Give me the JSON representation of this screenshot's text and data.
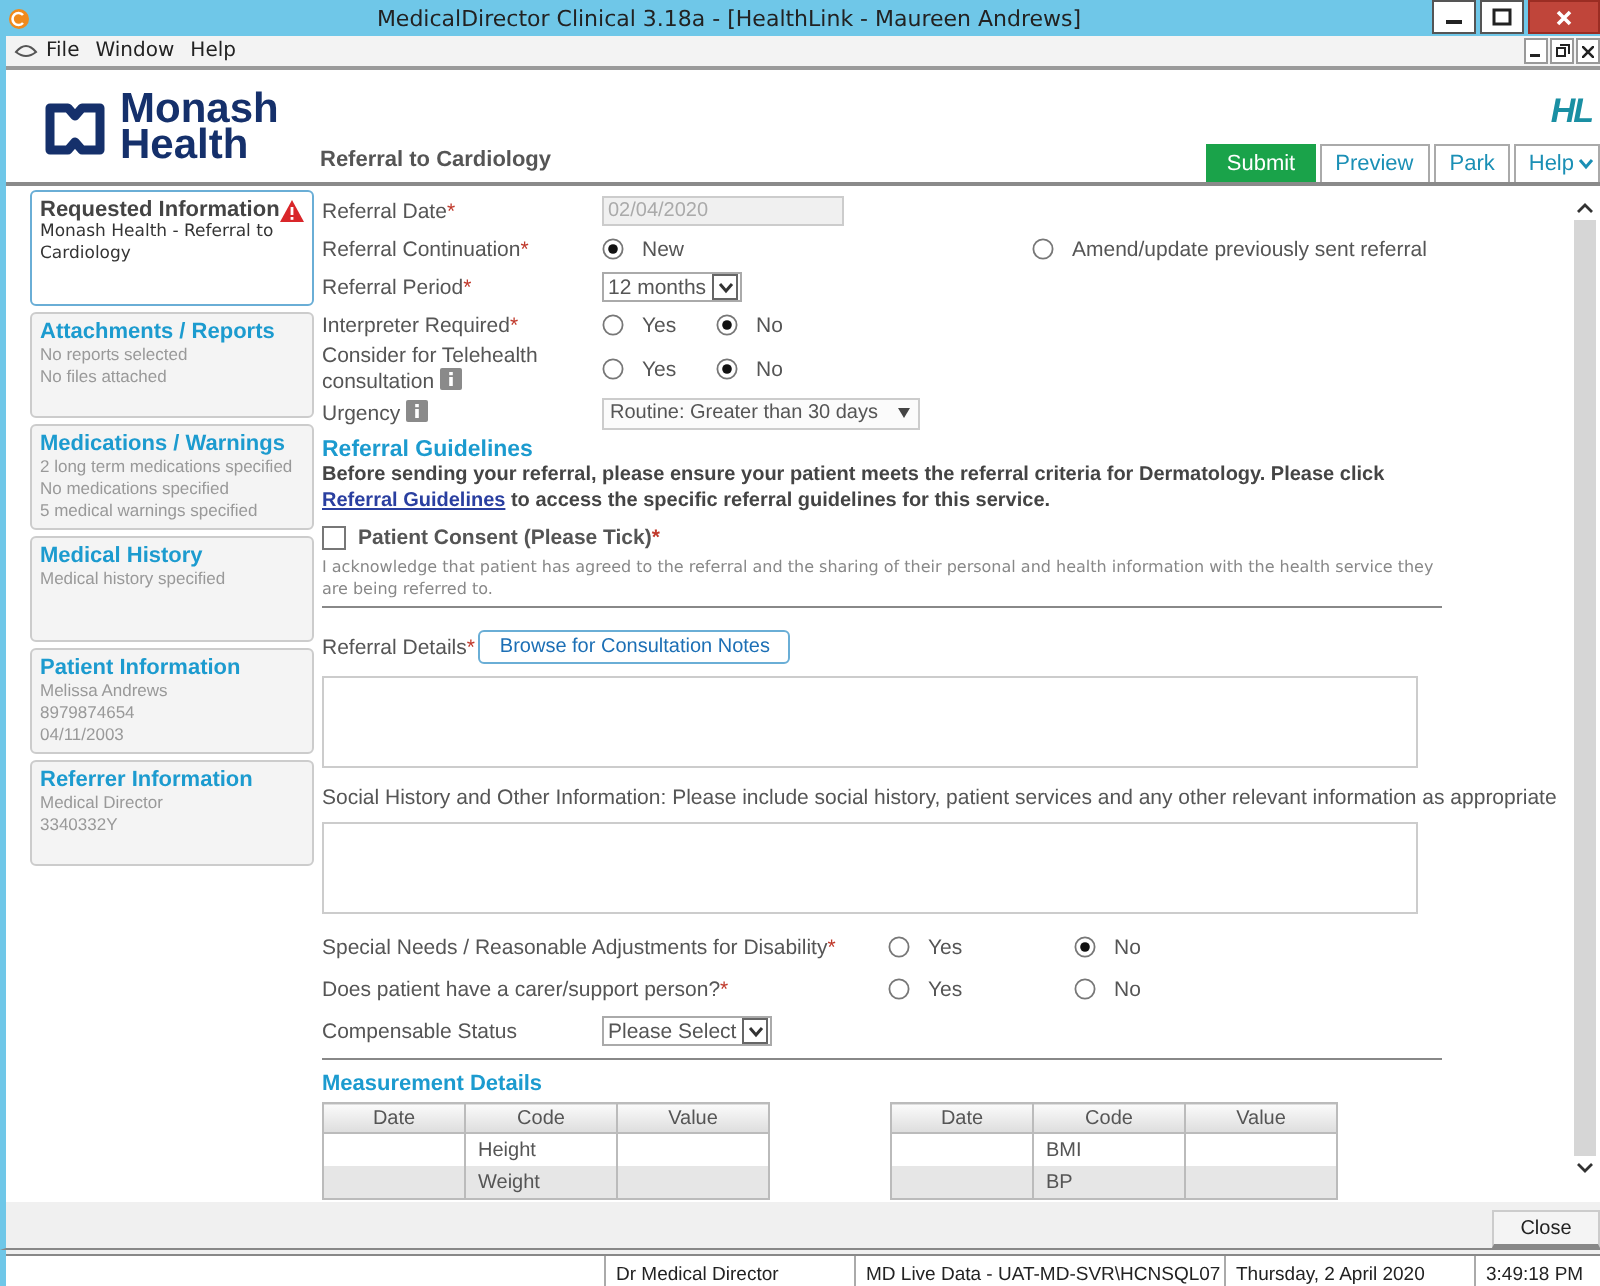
{
  "window": {
    "title": "MedicalDirector Clinical 3.18a - [HealthLink - Maureen Andrews]"
  },
  "menu": [
    "File",
    "Window",
    "Help"
  ],
  "header": {
    "logo_lines": [
      "Monash",
      "Health"
    ],
    "form_title": "Referral to Cardiology",
    "badge": "HL"
  },
  "toolbar": [
    {
      "label": "Submit",
      "kind": "primary"
    },
    {
      "label": "Preview",
      "kind": "plain"
    },
    {
      "label": "Park",
      "kind": "plain"
    },
    {
      "label": "Help",
      "kind": "menu"
    }
  ],
  "sidebar": [
    {
      "title": "Requested Information",
      "lines": [
        "Monash Health - Referral to Cardiology"
      ],
      "selected": true,
      "warning": true
    },
    {
      "title": "Attachments / Reports",
      "lines": [
        "No reports selected",
        "No files attached"
      ],
      "selected": false,
      "warning": false
    },
    {
      "title": "Medications / Warnings",
      "lines": [
        "2 long term medications specified",
        "No medications specified",
        "5 medical warnings specified"
      ],
      "selected": false,
      "warning": false
    },
    {
      "title": "Medical History",
      "lines": [
        "Medical history specified"
      ],
      "selected": false,
      "warning": false
    },
    {
      "title": "Patient Information",
      "lines": [
        "Melissa Andrews",
        "8979874654",
        "04/11/2003"
      ],
      "selected": false,
      "warning": false
    },
    {
      "title": "Referrer Information",
      "lines": [
        "Medical Director",
        "3340332Y"
      ],
      "selected": false,
      "warning": false
    }
  ],
  "form": {
    "top_fields": [
      {
        "kind": "date",
        "label": "Referral Date",
        "marker": "*",
        "value": "02/04/2020",
        "disabled": true
      },
      {
        "kind": "radio-wide",
        "label": "Referral Continuation",
        "marker": "*",
        "options": [
          {
            "label": "New",
            "selected": true
          },
          {
            "label": "Amend/update previously sent referral",
            "selected": false
          }
        ]
      },
      {
        "kind": "select",
        "label": "Referral Period",
        "marker": "*",
        "value": "12 months"
      },
      {
        "kind": "radio",
        "label": "Interpreter Required",
        "marker": "*",
        "options": [
          {
            "label": "Yes",
            "selected": false
          },
          {
            "label": "No",
            "selected": true
          }
        ]
      },
      {
        "kind": "radio",
        "label": "Consider for Telehealth consultation",
        "info": true,
        "options": [
          {
            "label": "Yes",
            "selected": false
          },
          {
            "label": "No",
            "selected": true
          }
        ]
      },
      {
        "kind": "dropdown",
        "label": "Urgency",
        "info": true,
        "value": "Routine: Greater than 30 days"
      }
    ],
    "guidelines": {
      "heading": "Referral Guidelines",
      "text_before": "Before sending your referral, please ensure your patient meets the referral criteria for Dermatology.  Please click",
      "link": "Referral Guidelines",
      "text_after": "to access the specific referral guidelines for this service."
    },
    "consent": {
      "label": "Patient Consent (Please Tick)",
      "marker": "*",
      "checked": false,
      "note": "I acknowledge that patient has agreed to the referral and the sharing of their personal and health information with the health service they are being referred to."
    },
    "referral_details": {
      "label": "Referral Details",
      "marker": "*",
      "button": "Browse for Consultation Notes"
    },
    "social_history": {
      "label": "Social History and Other Information: Please include social history, patient services and any other relevant information as appropriate"
    },
    "bottom_fields": [
      {
        "kind": "radio",
        "label": "Special Needs / Reasonable Adjustments for Disability",
        "marker": "*",
        "options": [
          {
            "label": "Yes",
            "selected": false
          },
          {
            "label": "No",
            "selected": true
          }
        ]
      },
      {
        "kind": "radio",
        "label": "Does patient have a carer/support person?",
        "marker": "*",
        "options": [
          {
            "label": "Yes",
            "selected": false
          },
          {
            "label": "No",
            "selected": false
          }
        ]
      },
      {
        "kind": "select",
        "label": "Compensable Status",
        "value": "Please Select"
      }
    ],
    "measurements": {
      "heading": "Measurement Details",
      "tables": [
        {
          "columns": [
            "Date",
            "Code",
            "Value"
          ],
          "rows": [
            {
              "code": "Height"
            },
            {
              "code": "Weight"
            }
          ]
        },
        {
          "columns": [
            "Date",
            "Code",
            "Value"
          ],
          "rows": [
            {
              "code": "BMI"
            },
            {
              "code": "BP"
            }
          ]
        }
      ]
    }
  },
  "footer": {
    "button": "Close"
  },
  "status_bar": [
    "Dr Medical Director",
    "MD Live Data - UAT-MD-SVR\\HCNSQL07",
    "Thursday, 2 April 2020",
    "3:49:18 PM"
  ]
}
